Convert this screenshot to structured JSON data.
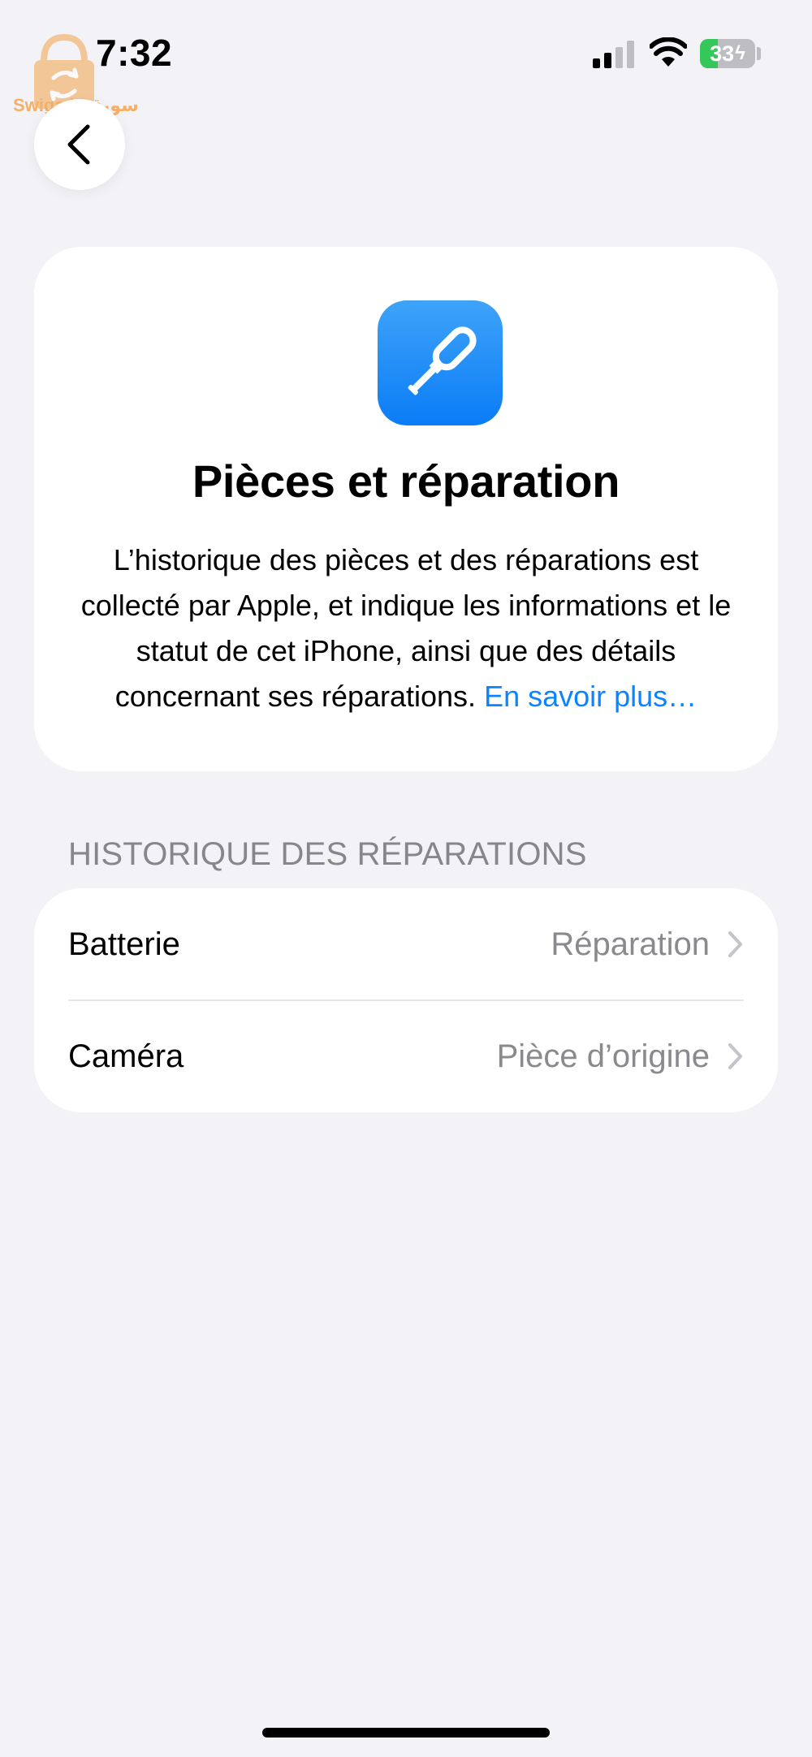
{
  "status_bar": {
    "time": "7:32",
    "battery_percent": 33,
    "battery_label": "33",
    "charging": true,
    "signal_bars_active": 2,
    "signal_bars_total": 4
  },
  "watermark": {
    "text": "Swiga | سويقة"
  },
  "hero": {
    "title": "Pièces et réparation",
    "description": "L’historique des pièces et des réparations est collecté par Apple, et indique les informations et le statut de cet iPhone, ainsi que des détails concernant ses réparations.",
    "learn_more": "En savoir plus…",
    "icon_color_top": "#3ea3f8",
    "icon_color_bottom": "#0a7cf6"
  },
  "repairs": {
    "section_title": "HISTORIQUE DES RÉPARATIONS",
    "items": [
      {
        "label": "Batterie",
        "value": "Réparation"
      },
      {
        "label": "Caméra",
        "value": "Pièce d’origine"
      }
    ]
  },
  "colors": {
    "background": "#f2f2f7",
    "link": "#0a84ff",
    "secondary_text": "#8a8a8e",
    "battery_green": "#34c759"
  }
}
